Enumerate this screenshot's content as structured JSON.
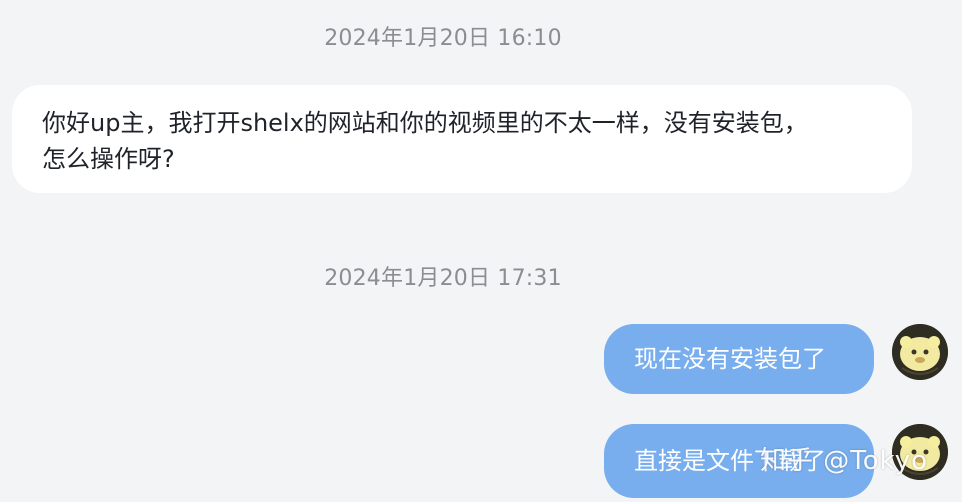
{
  "messages": [
    {
      "timestamp": "2024年1月20日 16:10",
      "direction": "incoming",
      "lines": [
        "你好up主，我打开shelx的网站和你的视频里的不太一样，没有安装包，",
        "怎么操作呀?"
      ]
    },
    {
      "timestamp": "2024年1月20日 17:31",
      "direction": "outgoing",
      "text": "现在没有安装包了"
    },
    {
      "direction": "outgoing",
      "text": "直接是文件下载了"
    }
  ],
  "watermark": "知乎 @Tokyo",
  "colors": {
    "background": "#f3f4f6",
    "incoming_bubble": "#ffffff",
    "outgoing_bubble": "#78aeee",
    "timestamp_text": "#8a8d91"
  },
  "avatar": {
    "icon": "cartoon-avatar-icon"
  }
}
